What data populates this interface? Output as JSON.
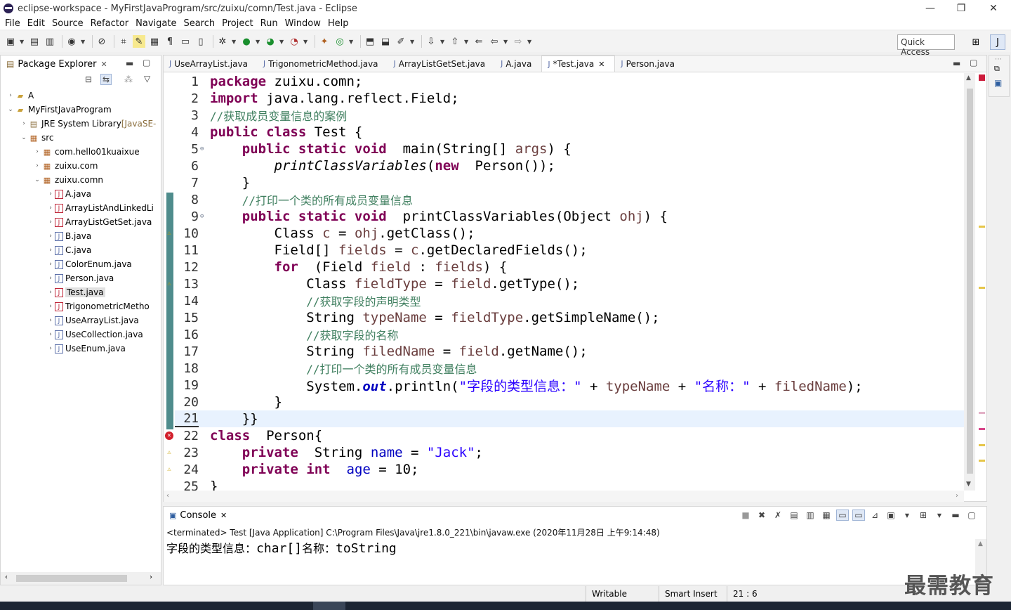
{
  "window": {
    "title": "eclipse-workspace - MyFirstJavaProgram/src/zuixu/comn/Test.java - Eclipse",
    "minimize": "—",
    "maximize": "❐",
    "close": "✕"
  },
  "menu": [
    "File",
    "Edit",
    "Source",
    "Refactor",
    "Navigate",
    "Search",
    "Project",
    "Run",
    "Window",
    "Help"
  ],
  "toolbar": {
    "quick_access": "Quick Access"
  },
  "package_explorer": {
    "title": "Package Explorer",
    "tree": [
      {
        "arrow": "›",
        "icon": "folder-icon",
        "label": "A",
        "deco": "",
        "indent": 0,
        "selected": false
      },
      {
        "arrow": "⌄",
        "icon": "project-icon",
        "label": "MyFirstJavaProgram",
        "deco": "",
        "indent": 0,
        "selected": false
      },
      {
        "arrow": "›",
        "icon": "library-icon",
        "label": "JRE System Library",
        "deco": " [JavaSE-",
        "indent": 1,
        "selected": false
      },
      {
        "arrow": "⌄",
        "icon": "src-folder-icon",
        "label": "src",
        "deco": "",
        "indent": 1,
        "selected": false
      },
      {
        "arrow": "›",
        "icon": "package-icon",
        "label": "com.hello01kuaixue",
        "deco": "",
        "indent": 2,
        "selected": false
      },
      {
        "arrow": "›",
        "icon": "package-icon",
        "label": "zuixu.com",
        "deco": "",
        "indent": 2,
        "selected": false
      },
      {
        "arrow": "⌄",
        "icon": "package-icon",
        "label": "zuixu.comn",
        "deco": "",
        "indent": 2,
        "selected": false
      },
      {
        "arrow": "›",
        "icon": "java-file-error-icon",
        "label": "A.java",
        "deco": "",
        "indent": 3,
        "selected": false
      },
      {
        "arrow": "›",
        "icon": "java-file-error-icon",
        "label": "ArrayListAndLinkedLi",
        "deco": "",
        "indent": 3,
        "selected": false
      },
      {
        "arrow": "›",
        "icon": "java-file-error-icon",
        "label": "ArrayListGetSet.java",
        "deco": "",
        "indent": 3,
        "selected": false
      },
      {
        "arrow": "›",
        "icon": "java-file-icon",
        "label": "B.java",
        "deco": "",
        "indent": 3,
        "selected": false
      },
      {
        "arrow": "›",
        "icon": "java-file-icon",
        "label": "C.java",
        "deco": "",
        "indent": 3,
        "selected": false
      },
      {
        "arrow": "›",
        "icon": "java-file-icon",
        "label": "ColorEnum.java",
        "deco": "",
        "indent": 3,
        "selected": false
      },
      {
        "arrow": "›",
        "icon": "java-file-icon",
        "label": "Person.java",
        "deco": "",
        "indent": 3,
        "selected": false
      },
      {
        "arrow": "›",
        "icon": "java-file-error-icon",
        "label": "Test.java",
        "deco": "",
        "indent": 3,
        "selected": true
      },
      {
        "arrow": "›",
        "icon": "java-file-error-icon",
        "label": "TrigonometricMetho",
        "deco": "",
        "indent": 3,
        "selected": false
      },
      {
        "arrow": "›",
        "icon": "java-file-icon",
        "label": "UseArrayList.java",
        "deco": "",
        "indent": 3,
        "selected": false
      },
      {
        "arrow": "›",
        "icon": "java-file-icon",
        "label": "UseCollection.java",
        "deco": "",
        "indent": 3,
        "selected": false
      },
      {
        "arrow": "›",
        "icon": "java-file-icon",
        "label": "UseEnum.java",
        "deco": "",
        "indent": 3,
        "selected": false
      }
    ]
  },
  "editor": {
    "tabs": [
      {
        "label": "UseArrayList.java",
        "active": false
      },
      {
        "label": "TrigonometricMethod.java",
        "active": false
      },
      {
        "label": "ArrayListGetSet.java",
        "active": false
      },
      {
        "label": "A.java",
        "active": false
      },
      {
        "label": "*Test.java",
        "active": true
      },
      {
        "label": "Person.java",
        "active": false
      }
    ],
    "lines": [
      {
        "n": "1",
        "fold": "",
        "marker": "",
        "cur": false,
        "tokens": [
          [
            "kw",
            "package"
          ],
          [
            "",
            "zuixu.comn;"
          ]
        ]
      },
      {
        "n": "2",
        "fold": "",
        "marker": "",
        "cur": false,
        "tokens": [
          [
            "kw",
            "import"
          ],
          [
            "",
            "java.lang.reflect.Field;"
          ]
        ]
      },
      {
        "n": "3",
        "fold": "",
        "marker": "",
        "cur": false,
        "tokens": [
          [
            "cm",
            "//获取成员变量信息的案例"
          ]
        ]
      },
      {
        "n": "4",
        "fold": "",
        "marker": "",
        "cur": false,
        "tokens": [
          [
            "kw",
            "public class"
          ],
          [
            "",
            "Test {"
          ]
        ]
      },
      {
        "n": "5",
        "fold": "⊖",
        "marker": "",
        "cur": false,
        "tokens": [
          [
            "",
            "    "
          ],
          [
            "kw",
            "public static void"
          ],
          [
            "",
            " main(String[] "
          ],
          [
            "loc",
            "args"
          ],
          [
            "",
            ") {"
          ]
        ]
      },
      {
        "n": "6",
        "fold": "",
        "marker": "",
        "cur": false,
        "tokens": [
          [
            "",
            "        "
          ],
          [
            "ital",
            "printClassVariables"
          ],
          [
            "",
            "("
          ],
          [
            "kw",
            "new"
          ],
          [
            "",
            " Person());"
          ]
        ]
      },
      {
        "n": "7",
        "fold": "",
        "marker": "",
        "cur": false,
        "tokens": [
          [
            "",
            "    }"
          ]
        ]
      },
      {
        "n": "8",
        "fold": "",
        "marker": "",
        "cur": false,
        "tokens": [
          [
            "",
            "    "
          ],
          [
            "cm",
            "//打印一个类的所有成员变量信息"
          ]
        ]
      },
      {
        "n": "9",
        "fold": "⊖",
        "marker": "",
        "cur": false,
        "tokens": [
          [
            "",
            "    "
          ],
          [
            "kw",
            "public static void"
          ],
          [
            "",
            " printClassVariables(Object "
          ],
          [
            "loc",
            "ohj"
          ],
          [
            "",
            ") {"
          ]
        ]
      },
      {
        "n": "10",
        "fold": "",
        "marker": "warn",
        "cur": false,
        "tokens": [
          [
            "",
            "        Class "
          ],
          [
            "loc",
            "c"
          ],
          [
            "",
            " = "
          ],
          [
            "loc",
            "ohj"
          ],
          [
            "",
            ".getClass();"
          ]
        ]
      },
      {
        "n": "11",
        "fold": "",
        "marker": "",
        "cur": false,
        "tokens": [
          [
            "",
            "        Field[] "
          ],
          [
            "loc",
            "fields"
          ],
          [
            "",
            " = "
          ],
          [
            "loc",
            "c"
          ],
          [
            "",
            ".getDeclaredFields();"
          ]
        ]
      },
      {
        "n": "12",
        "fold": "",
        "marker": "",
        "cur": false,
        "tokens": [
          [
            "",
            "        "
          ],
          [
            "kw",
            "for"
          ],
          [
            "",
            " (Field "
          ],
          [
            "loc",
            "field"
          ],
          [
            "",
            " : "
          ],
          [
            "loc",
            "fields"
          ],
          [
            "",
            ") {"
          ]
        ]
      },
      {
        "n": "13",
        "fold": "",
        "marker": "warn",
        "cur": false,
        "tokens": [
          [
            "",
            "            Class "
          ],
          [
            "loc",
            "fieldType"
          ],
          [
            "",
            " = "
          ],
          [
            "loc",
            "field"
          ],
          [
            "",
            ".getType();"
          ]
        ]
      },
      {
        "n": "14",
        "fold": "",
        "marker": "",
        "cur": false,
        "tokens": [
          [
            "",
            "            "
          ],
          [
            "cm",
            "//获取字段的声明类型"
          ]
        ]
      },
      {
        "n": "15",
        "fold": "",
        "marker": "",
        "cur": false,
        "tokens": [
          [
            "",
            "            String "
          ],
          [
            "loc",
            "typeName"
          ],
          [
            "",
            " = "
          ],
          [
            "loc",
            "fieldType"
          ],
          [
            "",
            ".getSimpleName();"
          ]
        ]
      },
      {
        "n": "16",
        "fold": "",
        "marker": "",
        "cur": false,
        "tokens": [
          [
            "",
            "            "
          ],
          [
            "cm",
            "//获取字段的名称"
          ]
        ]
      },
      {
        "n": "17",
        "fold": "",
        "marker": "",
        "cur": false,
        "tokens": [
          [
            "",
            "            String "
          ],
          [
            "loc",
            "filedName"
          ],
          [
            "",
            " = "
          ],
          [
            "loc",
            "field"
          ],
          [
            "",
            ".getName();"
          ]
        ]
      },
      {
        "n": "18",
        "fold": "",
        "marker": "",
        "cur": false,
        "tokens": [
          [
            "",
            "            "
          ],
          [
            "cm",
            "//打印一个类的所有成员变量信息"
          ]
        ]
      },
      {
        "n": "19",
        "fold": "",
        "marker": "",
        "cur": false,
        "tokens": [
          [
            "",
            "            System."
          ],
          [
            "stat",
            "out"
          ],
          [
            "",
            ".println("
          ],
          [
            "str",
            "\"字段的类型信息：\""
          ],
          [
            "",
            " + "
          ],
          [
            "loc",
            "typeName"
          ],
          [
            "",
            " + "
          ],
          [
            "str",
            "\"名称：\""
          ],
          [
            "",
            " + "
          ],
          [
            "loc",
            "filedName"
          ],
          [
            "",
            ");"
          ]
        ]
      },
      {
        "n": "20",
        "fold": "",
        "marker": "",
        "cur": false,
        "tokens": [
          [
            "",
            "        }"
          ]
        ]
      },
      {
        "n": "21",
        "fold": "",
        "marker": "",
        "cur": true,
        "tokens": [
          [
            "",
            "    }}"
          ]
        ]
      },
      {
        "n": "22",
        "fold": "",
        "marker": "error",
        "cur": false,
        "tokens": [
          [
            "kw",
            "class"
          ],
          [
            "",
            " Person{"
          ]
        ]
      },
      {
        "n": "23",
        "fold": "",
        "marker": "warn",
        "cur": false,
        "tokens": [
          [
            "",
            "    "
          ],
          [
            "kw",
            "private"
          ],
          [
            "",
            " String "
          ],
          [
            "fld",
            "name"
          ],
          [
            "",
            " = "
          ],
          [
            "str",
            "\"Jack\""
          ],
          [
            "",
            ";"
          ]
        ]
      },
      {
        "n": "24",
        "fold": "",
        "marker": "warn",
        "cur": false,
        "tokens": [
          [
            "",
            "    "
          ],
          [
            "kw",
            "private int"
          ],
          [
            "",
            " "
          ],
          [
            "fld",
            "age"
          ],
          [
            "",
            " = 10;"
          ]
        ]
      },
      {
        "n": "25",
        "fold": "",
        "marker": "",
        "cur": false,
        "tokens": [
          [
            "",
            "}"
          ]
        ]
      }
    ]
  },
  "console": {
    "title": "Console",
    "terminated": "<terminated> Test [Java Application] C:\\Program Files\\Java\\jre1.8.0_221\\bin\\javaw.exe (2020年11月28日 上午9:14:48)",
    "output_zh1": "字段的类型信息：",
    "output_code1": "char[]",
    "output_zh2": "名称：",
    "output_code2": "toString"
  },
  "status": {
    "writable": "Writable",
    "insert_mode": "Smart Insert",
    "position": "21 : 6"
  },
  "watermark": "最需教育",
  "colors": {
    "keyword": "#7f0055",
    "comment": "#3f7f5f",
    "string": "#2a00ff",
    "field": "#0000c0",
    "current_line": "#e8f2fe",
    "coverage": "#4f8c8c"
  }
}
